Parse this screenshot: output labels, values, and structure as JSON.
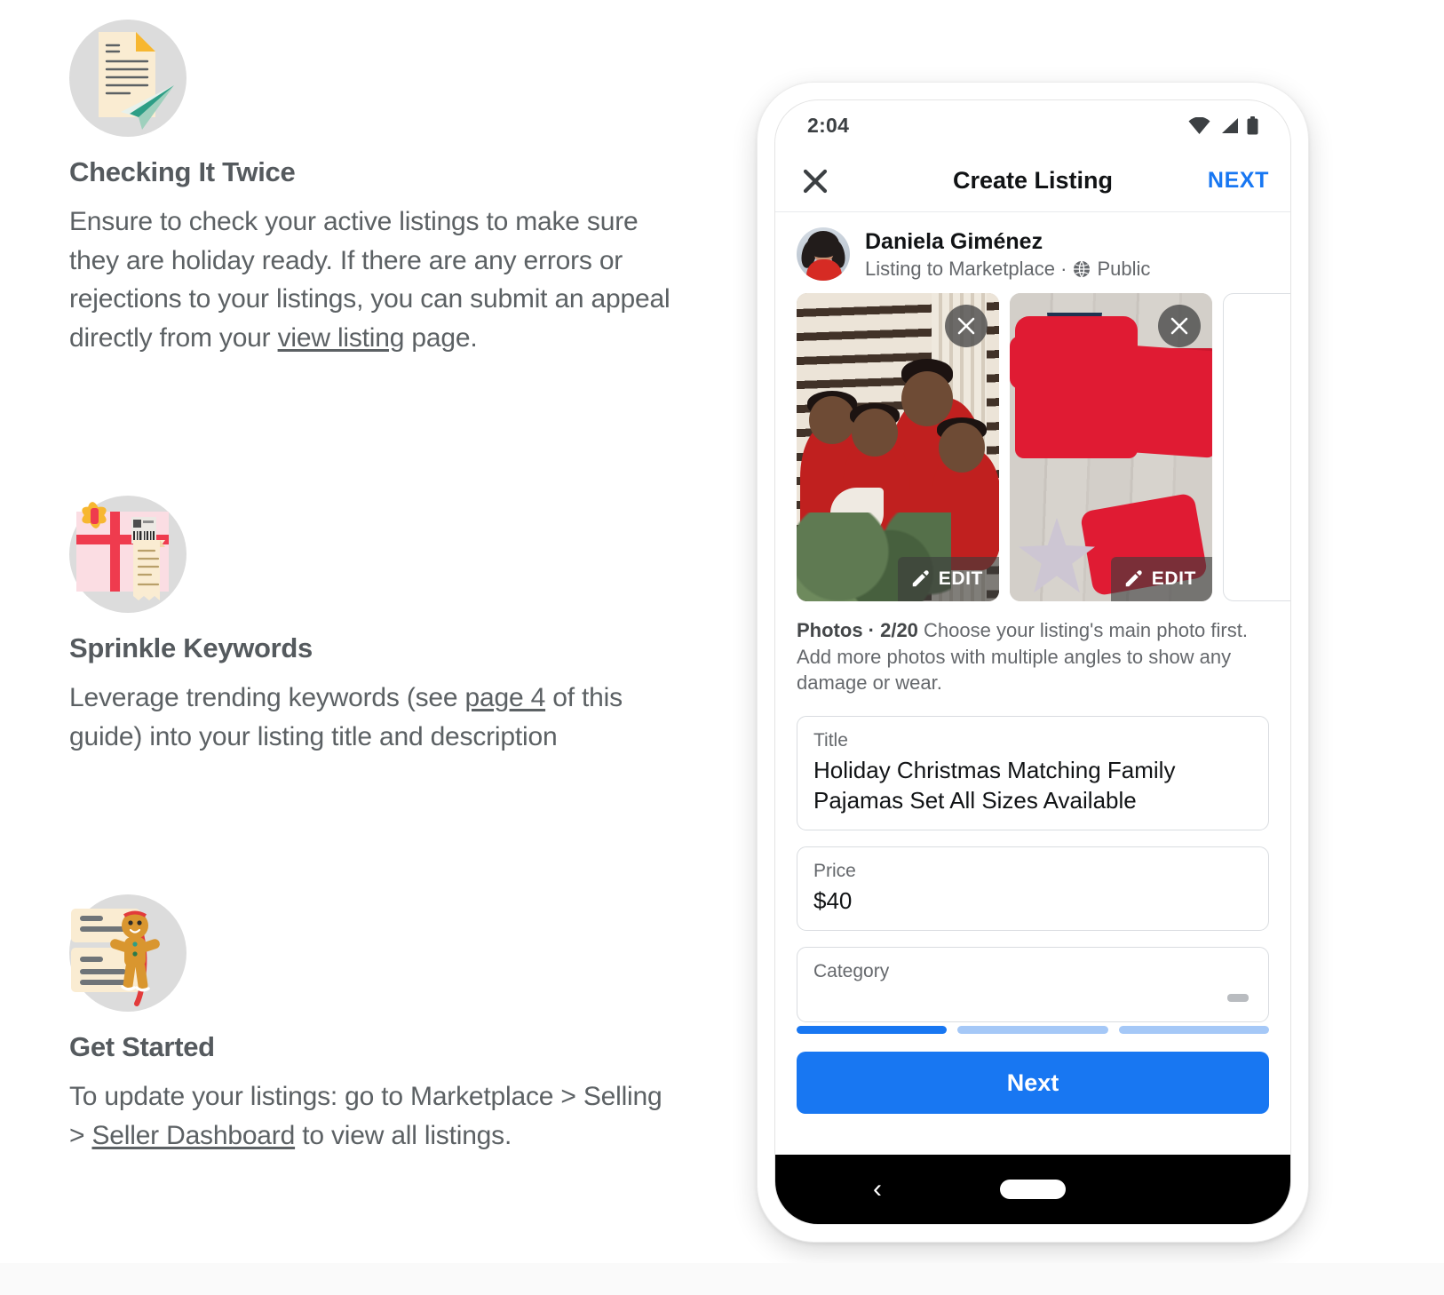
{
  "tips": [
    {
      "icon": "document-paper-plane-icon",
      "title": "Checking It Twice",
      "body_before": "Ensure to check your active listings to make sure they are holiday ready. If there are any errors or rejections to your listings, you can submit an appeal directly from your ",
      "link": "view listing",
      "body_after": " page."
    },
    {
      "icon": "gift-box-receipt-icon",
      "title": "Sprinkle Keywords",
      "body_before": "Leverage trending keywords (see ",
      "link": "page 4",
      "body_after": " of this guide) into your listing title and description"
    },
    {
      "icon": "gingerbread-man-list-icon",
      "title": "Get Started",
      "body_before": "To update your listings: go to Marketplace > Selling > ",
      "link": "Seller Dashboard",
      "body_after": " to view all listings."
    }
  ],
  "phone": {
    "status_bar": {
      "time": "2:04",
      "icons": [
        "wifi-icon",
        "cellular-signal-icon",
        "battery-icon"
      ]
    },
    "app_bar": {
      "close_icon": "close-icon",
      "title": "Create Listing",
      "next_label": "NEXT"
    },
    "author": {
      "avatar": "user-avatar",
      "name": "Daniela Giménez",
      "audience_prefix": "Listing to Marketplace · ",
      "privacy_icon": "globe-icon",
      "privacy": "Public"
    },
    "photos": {
      "tiles": [
        {
          "alt": "family-in-matching-christmas-pajamas-photo",
          "remove_icon": "close-icon",
          "edit_icon": "pencil-icon",
          "edit_label": "EDIT"
        },
        {
          "alt": "red-polka-dot-pajama-set-flatlay-photo",
          "remove_icon": "close-icon",
          "edit_icon": "pencil-icon",
          "edit_label": "EDIT"
        }
      ],
      "caption_label": "Photos · 2/20",
      "caption_text": " Choose your listing's main photo first. Add more photos with multiple angles to show any damage or wear."
    },
    "fields": [
      {
        "name": "title",
        "label": "Title",
        "value": "Holiday Christmas Matching Family Pajamas Set All Sizes Available"
      },
      {
        "name": "price",
        "label": "Price",
        "value": "$40"
      },
      {
        "name": "category",
        "label": "Category",
        "value": ""
      }
    ],
    "progress": {
      "segments": 3,
      "active": 1
    },
    "cta_label": "Next",
    "nav": {
      "back_icon": "chevron-left-icon",
      "home_pill": "home-indicator"
    }
  },
  "colors": {
    "accent_blue": "#1877f2",
    "progress_active": "#1877f2",
    "progress_inactive": "#a5c8f7",
    "heading_gray": "#555a5e",
    "body_gray": "#5c6164"
  }
}
